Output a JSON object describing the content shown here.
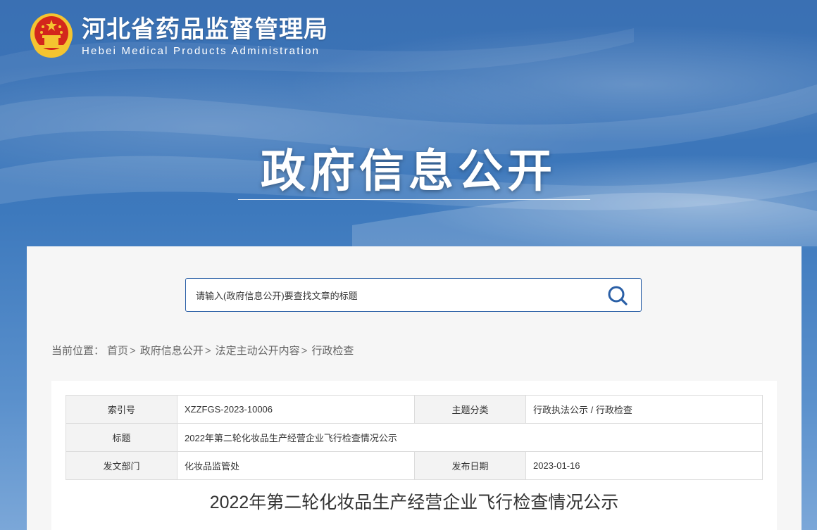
{
  "site": {
    "name_cn": "河北省药品监督管理局",
    "name_en": "Hebei Medical Products Administration",
    "emblem_icon": "national-emblem-icon"
  },
  "hero": {
    "title": "政府信息公开"
  },
  "search": {
    "placeholder": "请输入(政府信息公开)要查找文章的标题",
    "icon": "search-icon"
  },
  "breadcrumb": {
    "label": "当前位置：",
    "items": [
      "首页",
      "政府信息公开",
      "法定主动公开内容",
      "行政检查"
    ],
    "separator": ">"
  },
  "meta": {
    "index_label": "索引号",
    "index_value": "XZZFGS-2023-10006",
    "topic_label": "主题分类",
    "topic_value": "行政执法公示 / 行政检查",
    "title_label": "标题",
    "title_value": "2022年第二轮化妆品生产经营企业飞行检查情况公示",
    "dept_label": "发文部门",
    "dept_value": "化妆品监管处",
    "date_label": "发布日期",
    "date_value": "2023-01-16"
  },
  "article": {
    "title": "2022年第二轮化妆品生产经营企业飞行检查情况公示"
  },
  "colors": {
    "brand_blue": "#2a5fa6",
    "panel_bg": "#f6f6f6",
    "emblem_red": "#d3261c",
    "emblem_gold": "#f4c430"
  }
}
